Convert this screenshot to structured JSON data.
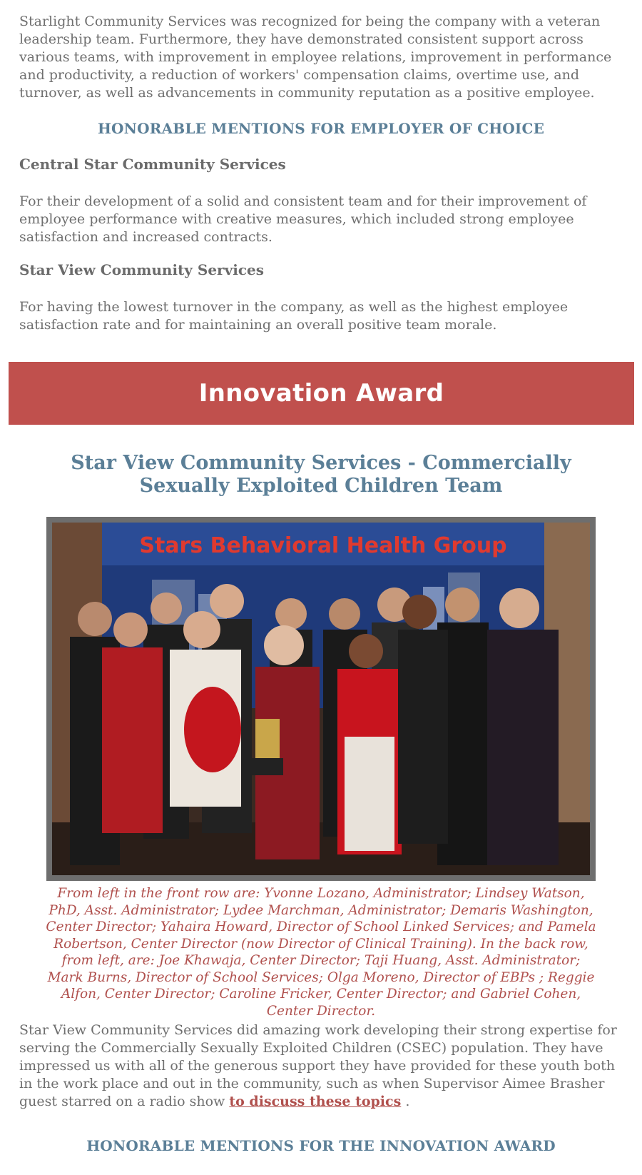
{
  "intro_paragraph": "Starlight Community Services was recognized for being the company with a veteran leadership team. Furthermore, they have demonstrated consistent support across various teams, with improvement in employee relations, improvement in performance and productivity, a reduction of workers' compensation claims, overtime use, and turnover, as well as advancements in community reputation as a positive employee.",
  "employer_honorable": {
    "heading": "HONORABLE MENTIONS FOR EMPLOYER OF CHOICE",
    "entries": [
      {
        "name": "Central Star Community Services",
        "text": "For their development of a solid and consistent team and for their improvement of employee performance with creative measures, which included strong employee satisfaction and increased contracts."
      },
      {
        "name": "Star View Community Services",
        "text": "For having the lowest turnover in the company, as well as the highest employee satisfaction rate and for maintaining an overall positive team morale."
      }
    ]
  },
  "innovation_banner": {
    "title": "Innovation Award",
    "color": "#c0504d"
  },
  "innovation_award": {
    "title": "Star View Community Services - Commercially Sexually Exploited Children Team",
    "photo_banner_text": "Stars Behavioral Health Group",
    "caption": "From left in the front row are:  Yvonne Lozano, Administrator; Lindsey Watson, PhD, Asst. Administrator; Lydee Marchman, Administrator; Demaris Washington, Center Director; Yahaira Howard, Director of School Linked Services; and Pamela Robertson, Center Director (now Director of Clinical Training).  In the back row, from left, are:  Joe Khawaja, Center Director; Taji Huang, Asst. Administrator; Mark Burns, Director of School Services; Olga Moreno, Director of EBPs ; Reggie Alfon, Center Director; Caroline Fricker, Center Director;  and Gabriel Cohen, Center Director.",
    "description_before_link": "Star View Community Services did amazing work developing their strong expertise for serving the Commercially Sexually Exploited Children (CSEC) population. They have impressed us with all of the generous support they have provided for these youth both in the work place and out in the community, such as when Supervisor Aimee Brasher guest starred on a radio show ",
    "description_link": "to discuss these topics",
    "description_after_link": " ."
  },
  "innovation_honorable": {
    "heading": "HONORABLE MENTIONS FOR THE INNOVATION AWARD"
  },
  "colors": {
    "heading_blue": "#5b7f97",
    "caption_red": "#b0504d",
    "body_gray": "#6f6f6f"
  }
}
